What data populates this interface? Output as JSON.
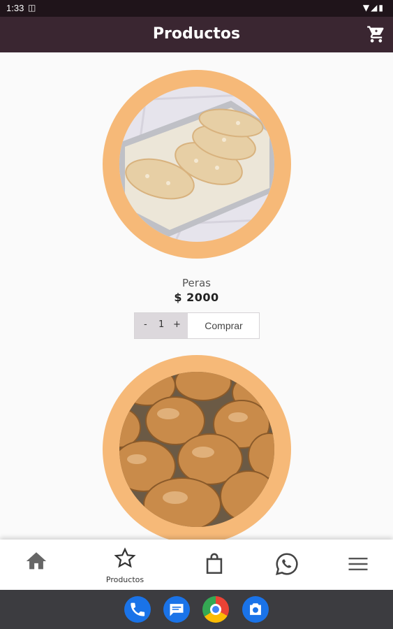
{
  "status_bar": {
    "time": "1:33"
  },
  "app_bar": {
    "title": "Productos"
  },
  "products": [
    {
      "name": "Peras",
      "price": "$ 2000",
      "quantity": "1",
      "decrement": "-",
      "increment": "+",
      "buy_label": "Comprar"
    },
    {
      "name": "",
      "price": ""
    }
  ],
  "bottom_nav": {
    "active_label": "Productos"
  },
  "colors": {
    "appbar": "#3a2631",
    "ring": "#f6b978",
    "background": "#fafafa"
  }
}
